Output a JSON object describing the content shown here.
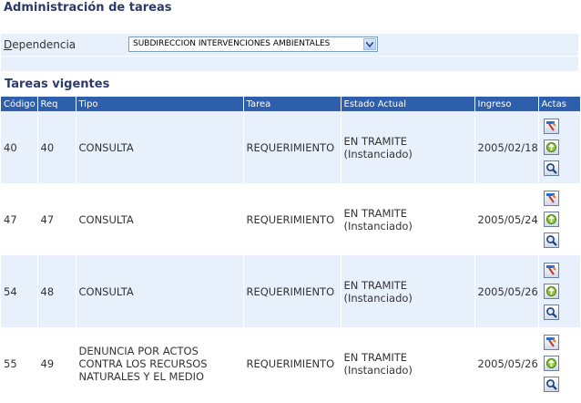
{
  "header": {
    "title": "Administración de tareas"
  },
  "filter": {
    "label_first": "D",
    "label_rest": "ependencia",
    "selected": "SUBDIRECCION INTERVENCIONES AMBIENTALES"
  },
  "section": {
    "title": "Tareas vigentes"
  },
  "table": {
    "columns": [
      "Código",
      "Req",
      "Tipo",
      "Tarea",
      "Estado Actual",
      "Ingreso",
      "Actas"
    ],
    "rows": [
      {
        "codigo": "40",
        "req": "40",
        "tipo": "CONSULTA",
        "tarea": "REQUERIMIENTO",
        "estado": "EN TRAMITE",
        "estado_sub": "(Instanciado)",
        "ingreso": "2005/02/18"
      },
      {
        "codigo": "47",
        "req": "47",
        "tipo": "CONSULTA",
        "tarea": "REQUERIMIENTO",
        "estado": "EN TRAMITE",
        "estado_sub": "(Instanciado)",
        "ingreso": "2005/05/24"
      },
      {
        "codigo": "54",
        "req": "48",
        "tipo": "CONSULTA",
        "tarea": "REQUERIMIENTO",
        "estado": "EN TRAMITE",
        "estado_sub": "(Instanciado)",
        "ingreso": "2005/05/26"
      },
      {
        "codigo": "55",
        "req": "49",
        "tipo": "DENUNCIA POR ACTOS CONTRA LOS RECURSOS NATURALES Y EL MEDIO",
        "tarea": "REQUERIMIENTO",
        "estado": "EN TRAMITE",
        "estado_sub": "(Instanciado)",
        "ingreso": "2005/05/26"
      }
    ]
  },
  "icons": {
    "edit": "edit-task-icon",
    "return": "return-icon",
    "view": "magnifier-icon"
  }
}
